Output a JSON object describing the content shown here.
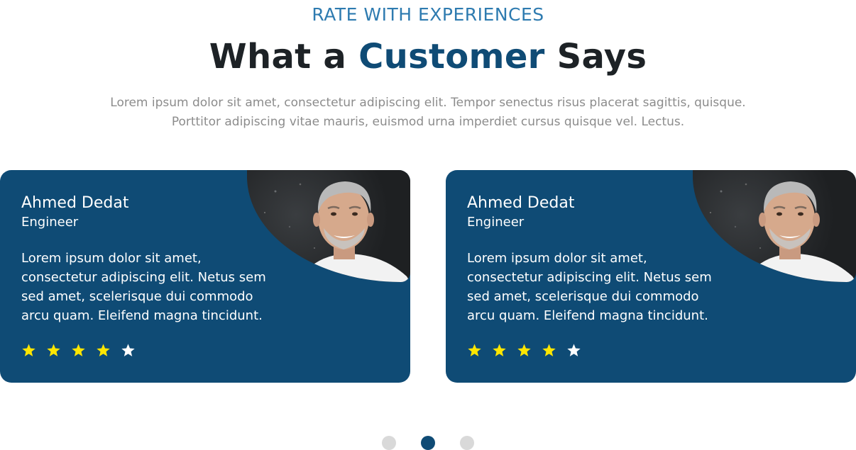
{
  "section": {
    "eyebrow": "RATE WITH EXPERIENCES",
    "title_part1": "What a ",
    "title_accent": "Customer",
    "title_part2": " Says",
    "subtitle": "Lorem ipsum dolor sit amet, consectetur adipiscing elit. Tempor senectus risus placerat sagittis, quisque. Porttitor adipiscing vitae mauris, euismod urna imperdiet cursus quisque vel. Lectus."
  },
  "testimonials": [
    {
      "name": "Ahmed Dedat",
      "role": "Engineer",
      "quote": "Lorem ipsum dolor sit amet, consectetur adipiscing elit. Netus sem sed amet, scelerisque dui commodo arcu quam. Eleifend magna tincidunt.",
      "rating": 4,
      "max_rating": 5,
      "photo": "man-portrait-photo"
    },
    {
      "name": "Ahmed Dedat",
      "role": "Engineer",
      "quote": "Lorem ipsum dolor sit amet, consectetur adipiscing elit. Netus sem sed amet, scelerisque dui commodo arcu quam. Eleifend magna tincidunt.",
      "rating": 4,
      "max_rating": 5,
      "photo": "man-portrait-photo"
    }
  ],
  "pagination": {
    "pages": 3,
    "active_index": 1
  },
  "colors": {
    "accent": "#0f4b75",
    "eyebrow": "#2e7bb0",
    "star_filled": "#ffe600",
    "star_empty": "#ffffff",
    "dot_inactive": "#d9d9d9"
  }
}
